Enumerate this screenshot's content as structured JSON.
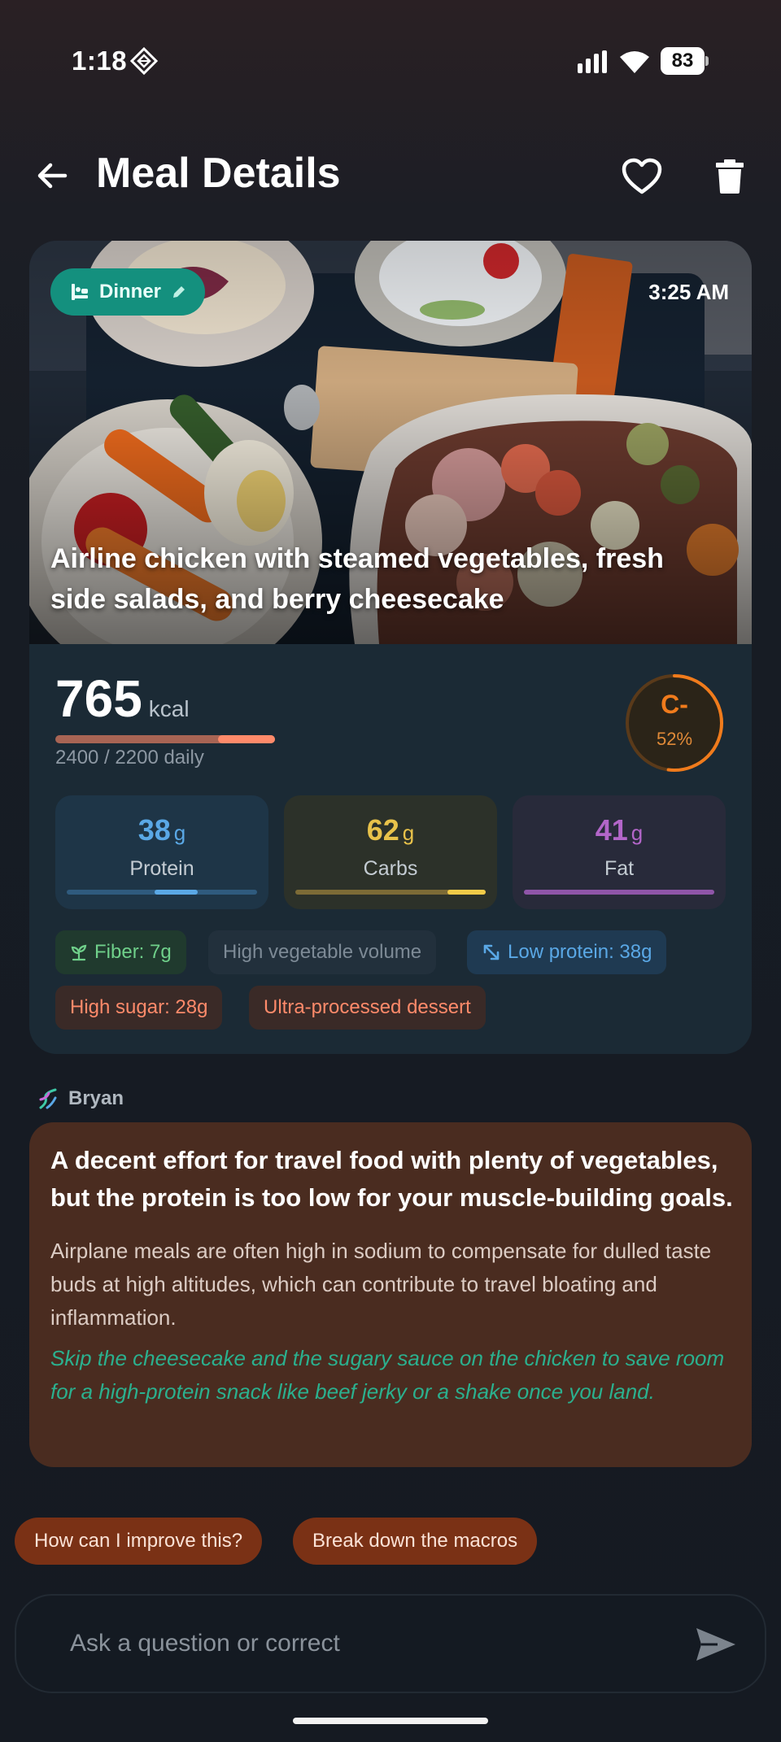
{
  "status_bar": {
    "time": "1:18",
    "battery": "83",
    "icons": [
      "app-diamond-icon",
      "signal-icon",
      "wifi-icon",
      "battery-icon"
    ]
  },
  "header": {
    "title": "Meal Details",
    "icons": [
      "back-arrow-icon",
      "heart-icon",
      "trash-icon"
    ]
  },
  "meal": {
    "type": "Dinner",
    "type_icon": "dinner-icon",
    "time": "3:25 AM",
    "name": "Airline chicken with steamed vegetables, fresh side salads, and berry cheesecake",
    "kcal": "765",
    "kcal_unit": "kcal",
    "daily": "2400 / 2200 daily",
    "kcal_progress": 1.09,
    "grade": "C-",
    "grade_percent": "52%",
    "grade_fraction": 0.52,
    "accent_color": "#f07b1c"
  },
  "macros": [
    {
      "value": "38",
      "unit": "g",
      "label": "Protein",
      "color": "#5aa8e6",
      "fill_start": 0.46,
      "fill_end": 0.69
    },
    {
      "value": "62",
      "unit": "g",
      "label": "Carbs",
      "color": "#e8c24a",
      "fill_start": 0.8,
      "fill_end": 1.0
    },
    {
      "value": "41",
      "unit": "g",
      "label": "Fat",
      "color": "#b366c9",
      "fill_start": 0.0,
      "fill_end": 1.0
    }
  ],
  "tags": [
    {
      "label": "Fiber: 7g",
      "icon": "sprout-icon",
      "color": "#6fd08a"
    },
    {
      "label": "High vegetable volume",
      "color": "#7d8a96"
    },
    {
      "label": "Low protein: 38g",
      "icon": "arrow-down-left-icon",
      "color": "#5aa8e6"
    },
    {
      "label": "High sugar: 28g",
      "color": "#ff8a6a"
    },
    {
      "label": "Ultra-processed dessert",
      "color": "#ff8a6a"
    }
  ],
  "coach": {
    "name": "Bryan",
    "icon": "dna-icon",
    "headline": "A decent effort for travel food with plenty of vegetables, but the protein is too low for your muscle-building goals.",
    "body": "Airplane meals are often high in sodium to compensate for dulled taste buds at high altitudes, which can contribute to travel bloating and inflammation.",
    "tip": "Skip the cheesecake and the sugary sauce on the chicken to save room for a high-protein snack like beef jerky or a shake once you land."
  },
  "suggestions": [
    "How can I improve this?",
    "Break down the macros"
  ],
  "input": {
    "placeholder": "Ask a question or correct",
    "send_icon": "send-icon"
  }
}
